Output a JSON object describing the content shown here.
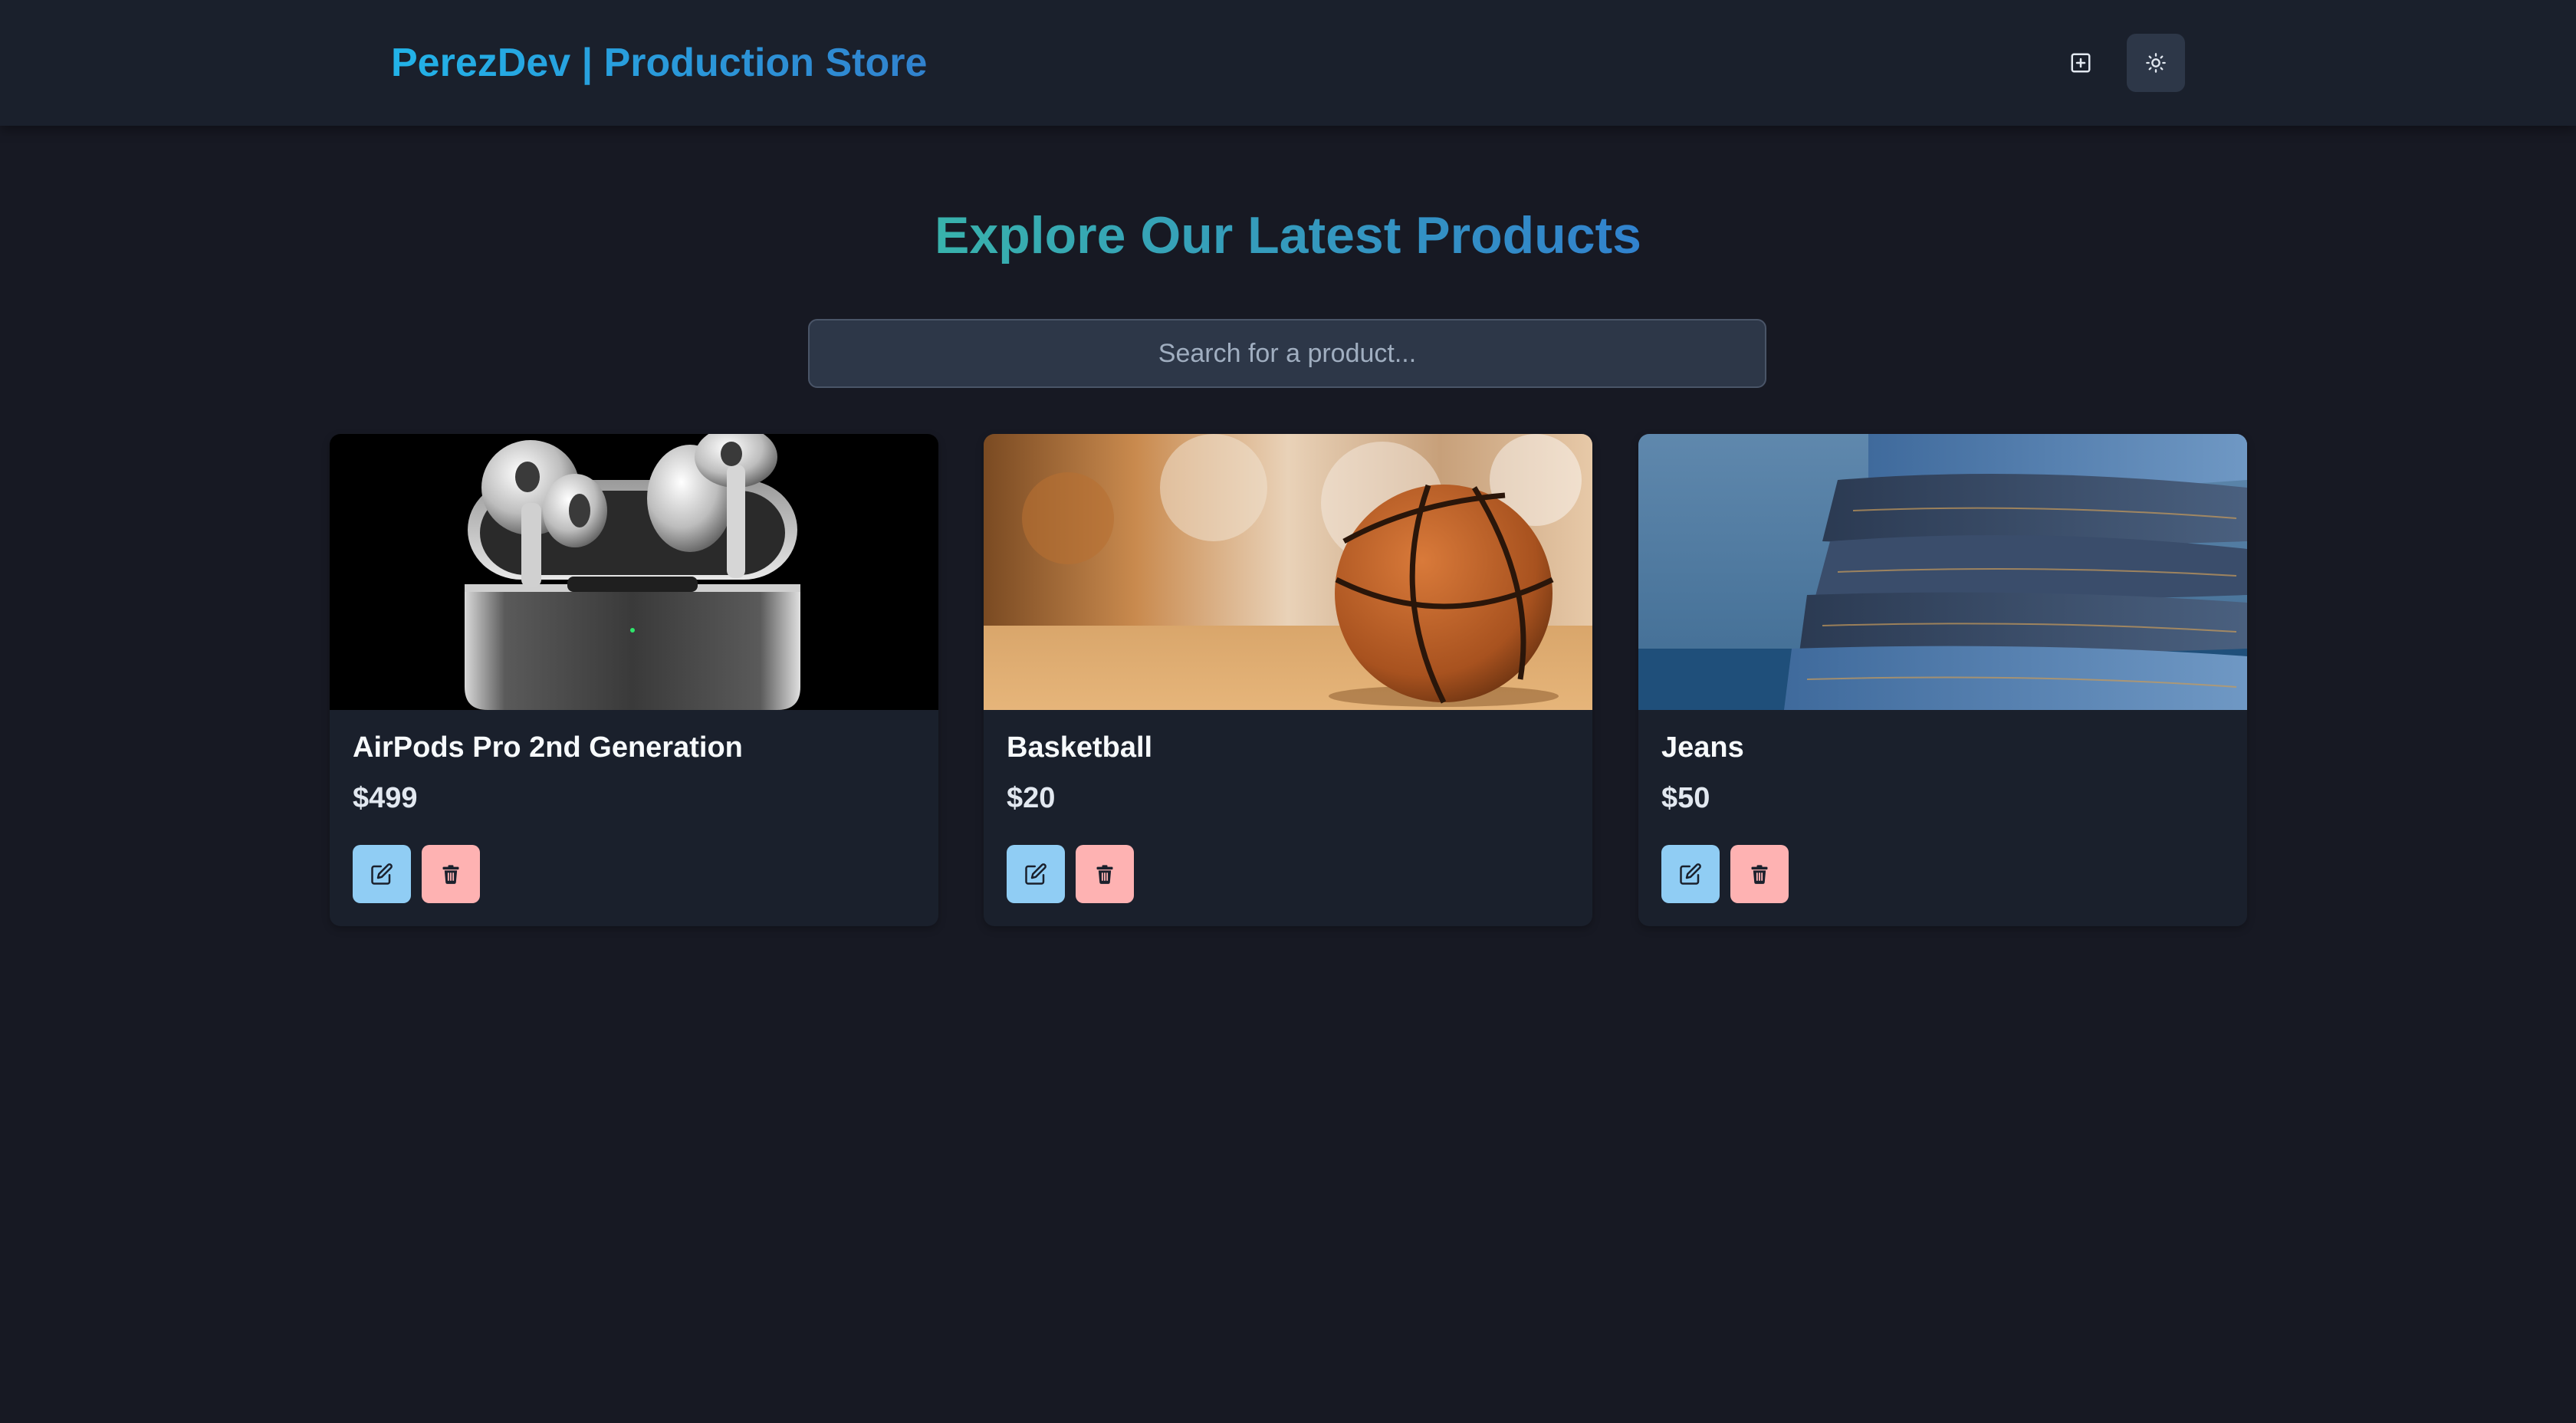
{
  "header": {
    "brand": "PerezDev | Production Store",
    "icons": {
      "create": "plus-square-icon",
      "theme": "sun-icon"
    }
  },
  "main": {
    "headline": "Explore Our Latest Products",
    "search": {
      "placeholder": "Search for a product...",
      "value": ""
    }
  },
  "products": [
    {
      "name": "AirPods Pro 2nd Generation",
      "price": "$499",
      "image": "airpods-image"
    },
    {
      "name": "Basketball",
      "price": "$20",
      "image": "basketball-image"
    },
    {
      "name": "Jeans",
      "price": "$50",
      "image": "jeans-image"
    }
  ],
  "colors": {
    "background": "#171923",
    "navbar": "#1a202c",
    "card": "#1a202c",
    "brand_gradient_start": "#22b3e8",
    "brand_gradient_end": "#3182ce",
    "headline_gradient_start": "#38b2ac",
    "edit_button": "#90cdf4",
    "delete_button": "#feb2b2"
  }
}
